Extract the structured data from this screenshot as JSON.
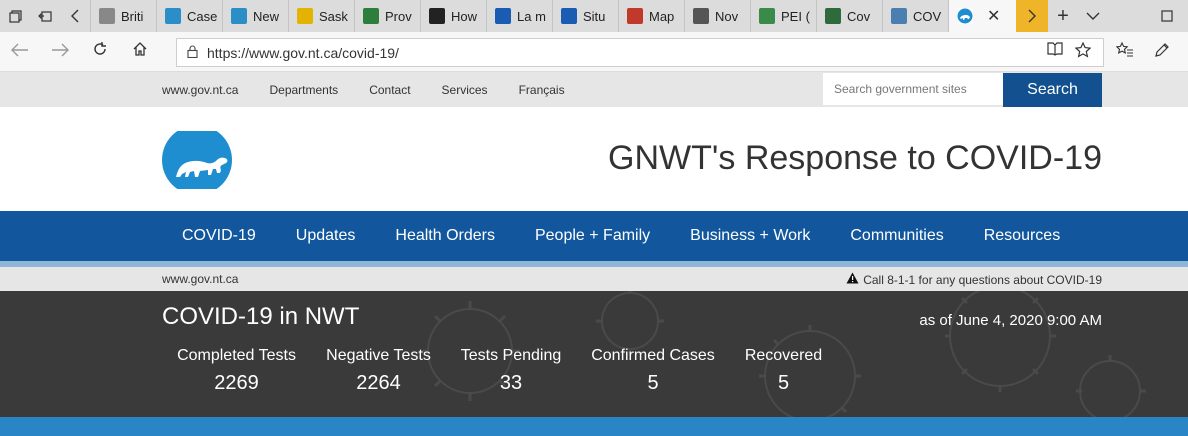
{
  "browser": {
    "tabs": [
      {
        "label": "Briti",
        "icon": "document-icon",
        "color": "#888888"
      },
      {
        "label": "Case",
        "icon": "alberta-icon",
        "color": "#2c8ec9"
      },
      {
        "label": "New",
        "icon": "alberta-icon",
        "color": "#2c8ec9"
      },
      {
        "label": "Sask",
        "icon": "wheat-icon",
        "color": "#e2b400"
      },
      {
        "label": "Prov",
        "icon": "manitoba-icon",
        "color": "#2d7d3b"
      },
      {
        "label": "How",
        "icon": "ontario-icon",
        "color": "#222222"
      },
      {
        "label": "La m",
        "icon": "quebec-icon",
        "color": "#1b5cb3"
      },
      {
        "label": "Situ",
        "icon": "quebec-icon",
        "color": "#1b5cb3"
      },
      {
        "label": "Map",
        "icon": "newbrunswick-icon",
        "color": "#c0392b"
      },
      {
        "label": "Nov",
        "icon": "novascotia-icon",
        "color": "#555555"
      },
      {
        "label": "PEI (",
        "icon": "pei-icon",
        "color": "#3a8a4a"
      },
      {
        "label": "Cov",
        "icon": "yukon-icon",
        "color": "#2f6b3a"
      },
      {
        "label": "COV",
        "icon": "nunavut-icon",
        "color": "#4a7fb0"
      }
    ],
    "url": "https://www.gov.nt.ca/covid-19/"
  },
  "util": {
    "links": [
      "www.gov.nt.ca",
      "Departments",
      "Contact",
      "Services",
      "Français"
    ],
    "search_placeholder": "Search government sites",
    "search_button": "Search"
  },
  "header": {
    "title": "GNWT's Response to COVID-19"
  },
  "nav": [
    "COVID-19",
    "Updates",
    "Health Orders",
    "People + Family",
    "Business + Work",
    "Communities",
    "Resources"
  ],
  "crumb": "www.gov.nt.ca",
  "alert": "Call 8-1-1 for any questions about COVID-19",
  "stats": {
    "title": "COVID-19 in NWT",
    "date": "as of June 4, 2020 9:00 AM",
    "items": [
      {
        "label": "Completed Tests",
        "value": "2269"
      },
      {
        "label": "Negative Tests",
        "value": "2264"
      },
      {
        "label": "Tests Pending",
        "value": "33"
      },
      {
        "label": "Confirmed Cases",
        "value": "5"
      },
      {
        "label": "Recovered",
        "value": "5"
      }
    ]
  },
  "colors": {
    "nav_blue": "#12579d",
    "search_blue": "#12508f",
    "stats_bg": "#3a3a3a",
    "logo_blue": "#1e8ed1"
  }
}
